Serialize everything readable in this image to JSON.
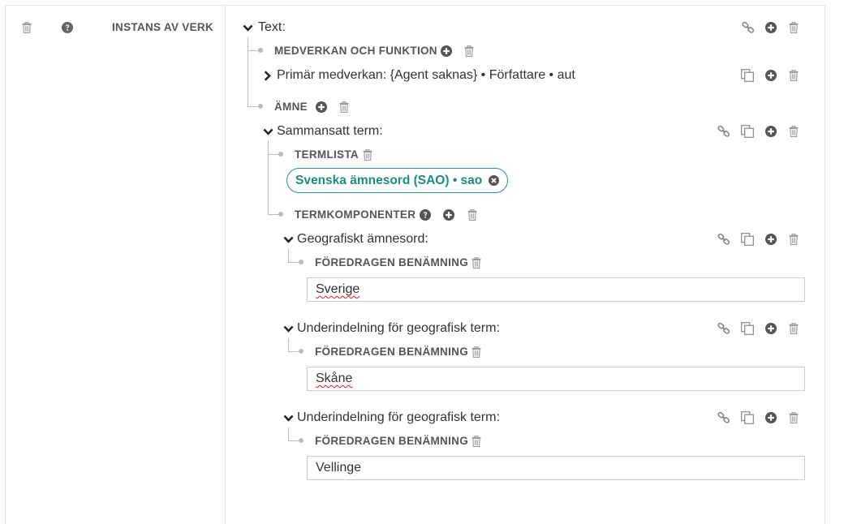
{
  "left": {
    "label": "INSTANS AV VERK",
    "icons": [
      "trash-icon",
      "help-icon"
    ]
  },
  "tree": {
    "text_header": "Text:",
    "medverkan_label": "MEDVERKAN OCH FUNKTION",
    "primar_medverkan": "Primär medverkan: {Agent saknas} • Författare • aut",
    "amne_label": "ÄMNE",
    "sammansatt_header": "Sammansatt term:",
    "termlista_label": "TERMLISTA",
    "termlista_pill": "Svenska ämnesord (SAO) • sao",
    "termkomponenter_label": "TERMKOMPONENTER",
    "components": [
      {
        "header": "Geografiskt ämnesord:",
        "field_label": "FÖREDRAGEN BENÄMNING",
        "value": "Sverige"
      },
      {
        "header": "Underindelning för geografisk term:",
        "field_label": "FÖREDRAGEN BENÄMNING",
        "value": "Skåne"
      },
      {
        "header": "Underindelning för geografisk term:",
        "field_label": "FÖREDRAGEN BENÄMNING",
        "value": "Vellinge"
      }
    ]
  },
  "colors": {
    "accent": "#1f8a83",
    "icon": "#8a8a8a",
    "icon_dark": "#555555",
    "text": "#333333",
    "spellcheck": "#e02020"
  }
}
